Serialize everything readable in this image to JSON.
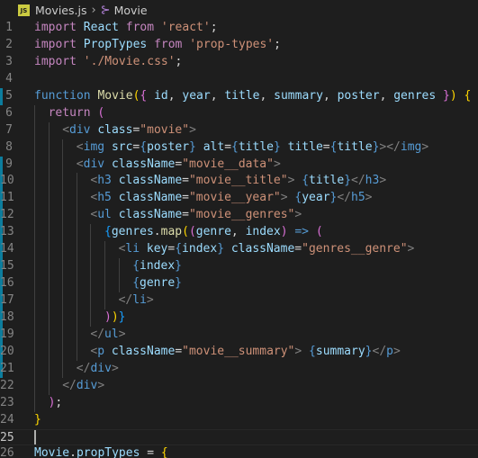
{
  "breadcrumb": {
    "file_icon_text": "JS",
    "file_name": "Movies.js",
    "separator": "›",
    "symbol_icon": "symbol-class-icon",
    "symbol_name": "Movie"
  },
  "colors": {
    "background": "#1e1e1e",
    "keyword": "#c586c0",
    "string": "#ce9178",
    "function": "#dcdcaa",
    "variable": "#9cdcfe",
    "type": "#4ec9b0",
    "tag": "#569cd6",
    "modified_gutter": "#0c7d9d"
  },
  "editor": {
    "lines": [
      {
        "n": "1",
        "indent": 0,
        "tokens": [
          {
            "c": "kw",
            "t": "import"
          },
          {
            "c": "tx",
            "t": " "
          },
          {
            "c": "vr",
            "t": "React"
          },
          {
            "c": "tx",
            "t": " "
          },
          {
            "c": "kw",
            "t": "from"
          },
          {
            "c": "tx",
            "t": " "
          },
          {
            "c": "st",
            "t": "'react'"
          },
          {
            "c": "tx",
            "t": ";"
          }
        ]
      },
      {
        "n": "2",
        "indent": 0,
        "tokens": [
          {
            "c": "kw",
            "t": "import"
          },
          {
            "c": "tx",
            "t": " "
          },
          {
            "c": "vr",
            "t": "PropTypes"
          },
          {
            "c": "tx",
            "t": " "
          },
          {
            "c": "kw",
            "t": "from"
          },
          {
            "c": "tx",
            "t": " "
          },
          {
            "c": "st",
            "t": "'prop-types'"
          },
          {
            "c": "tx",
            "t": ";"
          }
        ]
      },
      {
        "n": "3",
        "indent": 0,
        "tokens": [
          {
            "c": "kw",
            "t": "import"
          },
          {
            "c": "tx",
            "t": " "
          },
          {
            "c": "st",
            "t": "'./Movie.css'"
          },
          {
            "c": "tx",
            "t": ";"
          }
        ]
      },
      {
        "n": "4",
        "indent": 0,
        "tokens": []
      },
      {
        "n": "5",
        "indent": 0,
        "modified": true,
        "tokens": [
          {
            "c": "tg",
            "t": "function"
          },
          {
            "c": "tx",
            "t": " "
          },
          {
            "c": "fn",
            "t": "Movie"
          },
          {
            "c": "br1",
            "t": "("
          },
          {
            "c": "br2",
            "t": "{"
          },
          {
            "c": "tx",
            "t": " "
          },
          {
            "c": "vr",
            "t": "id"
          },
          {
            "c": "tx",
            "t": ", "
          },
          {
            "c": "vr",
            "t": "year"
          },
          {
            "c": "tx",
            "t": ", "
          },
          {
            "c": "vr",
            "t": "title"
          },
          {
            "c": "tx",
            "t": ", "
          },
          {
            "c": "vr",
            "t": "summary"
          },
          {
            "c": "tx",
            "t": ", "
          },
          {
            "c": "vr",
            "t": "poster"
          },
          {
            "c": "tx",
            "t": ", "
          },
          {
            "c": "vr",
            "t": "genres"
          },
          {
            "c": "tx",
            "t": " "
          },
          {
            "c": "br2",
            "t": "}"
          },
          {
            "c": "br1",
            "t": ")"
          },
          {
            "c": "tx",
            "t": " "
          },
          {
            "c": "br1",
            "t": "{"
          }
        ]
      },
      {
        "n": "6",
        "indent": 1,
        "tokens": [
          {
            "c": "kw",
            "t": "return"
          },
          {
            "c": "tx",
            "t": " "
          },
          {
            "c": "br2",
            "t": "("
          }
        ]
      },
      {
        "n": "7",
        "indent": 2,
        "tokens": [
          {
            "c": "pu",
            "t": "<"
          },
          {
            "c": "tg",
            "t": "div"
          },
          {
            "c": "tx",
            "t": " "
          },
          {
            "c": "vr",
            "t": "class"
          },
          {
            "c": "tx",
            "t": "="
          },
          {
            "c": "st",
            "t": "\"movie\""
          },
          {
            "c": "pu",
            "t": ">"
          }
        ]
      },
      {
        "n": "8",
        "indent": 3,
        "tokens": [
          {
            "c": "pu",
            "t": "<"
          },
          {
            "c": "tg",
            "t": "img"
          },
          {
            "c": "tx",
            "t": " "
          },
          {
            "c": "vr",
            "t": "src"
          },
          {
            "c": "tx",
            "t": "="
          },
          {
            "c": "tg",
            "t": "{"
          },
          {
            "c": "vr",
            "t": "poster"
          },
          {
            "c": "tg",
            "t": "}"
          },
          {
            "c": "tx",
            "t": " "
          },
          {
            "c": "vr",
            "t": "alt"
          },
          {
            "c": "tx",
            "t": "="
          },
          {
            "c": "tg",
            "t": "{"
          },
          {
            "c": "vr",
            "t": "title"
          },
          {
            "c": "tg",
            "t": "}"
          },
          {
            "c": "tx",
            "t": " "
          },
          {
            "c": "vr",
            "t": "title"
          },
          {
            "c": "tx",
            "t": "="
          },
          {
            "c": "tg",
            "t": "{"
          },
          {
            "c": "vr",
            "t": "title"
          },
          {
            "c": "tg",
            "t": "}"
          },
          {
            "c": "pu",
            "t": "></"
          },
          {
            "c": "tg",
            "t": "img"
          },
          {
            "c": "pu",
            "t": ">"
          }
        ]
      },
      {
        "n": "9",
        "indent": 3,
        "modified": true,
        "tokens": [
          {
            "c": "pu",
            "t": "<"
          },
          {
            "c": "tg",
            "t": "div"
          },
          {
            "c": "tx",
            "t": " "
          },
          {
            "c": "vr",
            "t": "className"
          },
          {
            "c": "tx",
            "t": "="
          },
          {
            "c": "st",
            "t": "\"movie__data\""
          },
          {
            "c": "pu",
            "t": ">"
          }
        ]
      },
      {
        "n": "10",
        "indent": 4,
        "modified": true,
        "tokens": [
          {
            "c": "pu",
            "t": "<"
          },
          {
            "c": "tg",
            "t": "h3"
          },
          {
            "c": "tx",
            "t": " "
          },
          {
            "c": "vr",
            "t": "className"
          },
          {
            "c": "tx",
            "t": "="
          },
          {
            "c": "st",
            "t": "\"movie__title\""
          },
          {
            "c": "pu",
            "t": ">"
          },
          {
            "c": "tx",
            "t": " "
          },
          {
            "c": "tg",
            "t": "{"
          },
          {
            "c": "vr",
            "t": "title"
          },
          {
            "c": "tg",
            "t": "}"
          },
          {
            "c": "pu",
            "t": "</"
          },
          {
            "c": "tg",
            "t": "h3"
          },
          {
            "c": "pu",
            "t": ">"
          }
        ]
      },
      {
        "n": "11",
        "indent": 4,
        "modified": true,
        "tokens": [
          {
            "c": "pu",
            "t": "<"
          },
          {
            "c": "tg",
            "t": "h5"
          },
          {
            "c": "tx",
            "t": " "
          },
          {
            "c": "vr",
            "t": "className"
          },
          {
            "c": "tx",
            "t": "="
          },
          {
            "c": "st",
            "t": "\"movie__year\""
          },
          {
            "c": "pu",
            "t": ">"
          },
          {
            "c": "tx",
            "t": " "
          },
          {
            "c": "tg",
            "t": "{"
          },
          {
            "c": "vr",
            "t": "year"
          },
          {
            "c": "tg",
            "t": "}"
          },
          {
            "c": "pu",
            "t": "</"
          },
          {
            "c": "tg",
            "t": "h5"
          },
          {
            "c": "pu",
            "t": ">"
          }
        ]
      },
      {
        "n": "12",
        "indent": 4,
        "modified": true,
        "tokens": [
          {
            "c": "pu",
            "t": "<"
          },
          {
            "c": "tg",
            "t": "ul"
          },
          {
            "c": "tx",
            "t": " "
          },
          {
            "c": "vr",
            "t": "className"
          },
          {
            "c": "tx",
            "t": "="
          },
          {
            "c": "st",
            "t": "\"movie__genres\""
          },
          {
            "c": "pu",
            "t": ">"
          }
        ]
      },
      {
        "n": "13",
        "indent": 5,
        "modified": true,
        "tokens": [
          {
            "c": "br3",
            "t": "{"
          },
          {
            "c": "vr",
            "t": "genres"
          },
          {
            "c": "tx",
            "t": "."
          },
          {
            "c": "fn",
            "t": "map"
          },
          {
            "c": "br1",
            "t": "("
          },
          {
            "c": "br2",
            "t": "("
          },
          {
            "c": "vr",
            "t": "genre"
          },
          {
            "c": "tx",
            "t": ", "
          },
          {
            "c": "vr",
            "t": "index"
          },
          {
            "c": "br2",
            "t": ")"
          },
          {
            "c": "tx",
            "t": " "
          },
          {
            "c": "tg",
            "t": "=>"
          },
          {
            "c": "tx",
            "t": " "
          },
          {
            "c": "br2",
            "t": "("
          }
        ]
      },
      {
        "n": "14",
        "indent": 6,
        "modified": true,
        "tokens": [
          {
            "c": "pu",
            "t": "<"
          },
          {
            "c": "tg",
            "t": "li"
          },
          {
            "c": "tx",
            "t": " "
          },
          {
            "c": "vr",
            "t": "key"
          },
          {
            "c": "tx",
            "t": "="
          },
          {
            "c": "tg",
            "t": "{"
          },
          {
            "c": "vr",
            "t": "index"
          },
          {
            "c": "tg",
            "t": "}"
          },
          {
            "c": "tx",
            "t": " "
          },
          {
            "c": "vr",
            "t": "className"
          },
          {
            "c": "tx",
            "t": "="
          },
          {
            "c": "st",
            "t": "\"genres__genre\""
          },
          {
            "c": "pu",
            "t": ">"
          }
        ]
      },
      {
        "n": "15",
        "indent": 7,
        "modified": true,
        "tokens": [
          {
            "c": "tg",
            "t": "{"
          },
          {
            "c": "vr",
            "t": "index"
          },
          {
            "c": "tg",
            "t": "}"
          }
        ]
      },
      {
        "n": "16",
        "indent": 7,
        "modified": true,
        "tokens": [
          {
            "c": "tg",
            "t": "{"
          },
          {
            "c": "vr",
            "t": "genre"
          },
          {
            "c": "tg",
            "t": "}"
          }
        ]
      },
      {
        "n": "17",
        "indent": 6,
        "modified": true,
        "tokens": [
          {
            "c": "pu",
            "t": "</"
          },
          {
            "c": "tg",
            "t": "li"
          },
          {
            "c": "pu",
            "t": ">"
          }
        ]
      },
      {
        "n": "18",
        "indent": 5,
        "modified": true,
        "tokens": [
          {
            "c": "br2",
            "t": ")"
          },
          {
            "c": "br1",
            "t": ")"
          },
          {
            "c": "br3",
            "t": "}"
          }
        ]
      },
      {
        "n": "19",
        "indent": 4,
        "modified": true,
        "tokens": [
          {
            "c": "pu",
            "t": "</"
          },
          {
            "c": "tg",
            "t": "ul"
          },
          {
            "c": "pu",
            "t": ">"
          }
        ]
      },
      {
        "n": "20",
        "indent": 4,
        "modified": true,
        "tokens": [
          {
            "c": "pu",
            "t": "<"
          },
          {
            "c": "tg",
            "t": "p"
          },
          {
            "c": "tx",
            "t": " "
          },
          {
            "c": "vr",
            "t": "className"
          },
          {
            "c": "tx",
            "t": "="
          },
          {
            "c": "st",
            "t": "\"movie__summary\""
          },
          {
            "c": "pu",
            "t": ">"
          },
          {
            "c": "tx",
            "t": " "
          },
          {
            "c": "tg",
            "t": "{"
          },
          {
            "c": "vr",
            "t": "summary"
          },
          {
            "c": "tg",
            "t": "}"
          },
          {
            "c": "pu",
            "t": "</"
          },
          {
            "c": "tg",
            "t": "p"
          },
          {
            "c": "pu",
            "t": ">"
          }
        ]
      },
      {
        "n": "21",
        "indent": 3,
        "modified": true,
        "tokens": [
          {
            "c": "pu",
            "t": "</"
          },
          {
            "c": "tg",
            "t": "div"
          },
          {
            "c": "pu",
            "t": ">"
          }
        ]
      },
      {
        "n": "22",
        "indent": 2,
        "tokens": [
          {
            "c": "pu",
            "t": "</"
          },
          {
            "c": "tg",
            "t": "div"
          },
          {
            "c": "pu",
            "t": ">"
          }
        ]
      },
      {
        "n": "23",
        "indent": 1,
        "tokens": [
          {
            "c": "br2",
            "t": ")"
          },
          {
            "c": "tx",
            "t": ";"
          }
        ]
      },
      {
        "n": "24",
        "indent": 0,
        "tokens": [
          {
            "c": "br1",
            "t": "}"
          }
        ]
      },
      {
        "n": "25",
        "indent": 0,
        "current": true,
        "tokens": []
      },
      {
        "n": "26",
        "indent": 0,
        "tokens": [
          {
            "c": "vr",
            "t": "Movie"
          },
          {
            "c": "tx",
            "t": "."
          },
          {
            "c": "vr",
            "t": "propTypes"
          },
          {
            "c": "tx",
            "t": " = "
          },
          {
            "c": "br1",
            "t": "{"
          }
        ]
      }
    ]
  }
}
